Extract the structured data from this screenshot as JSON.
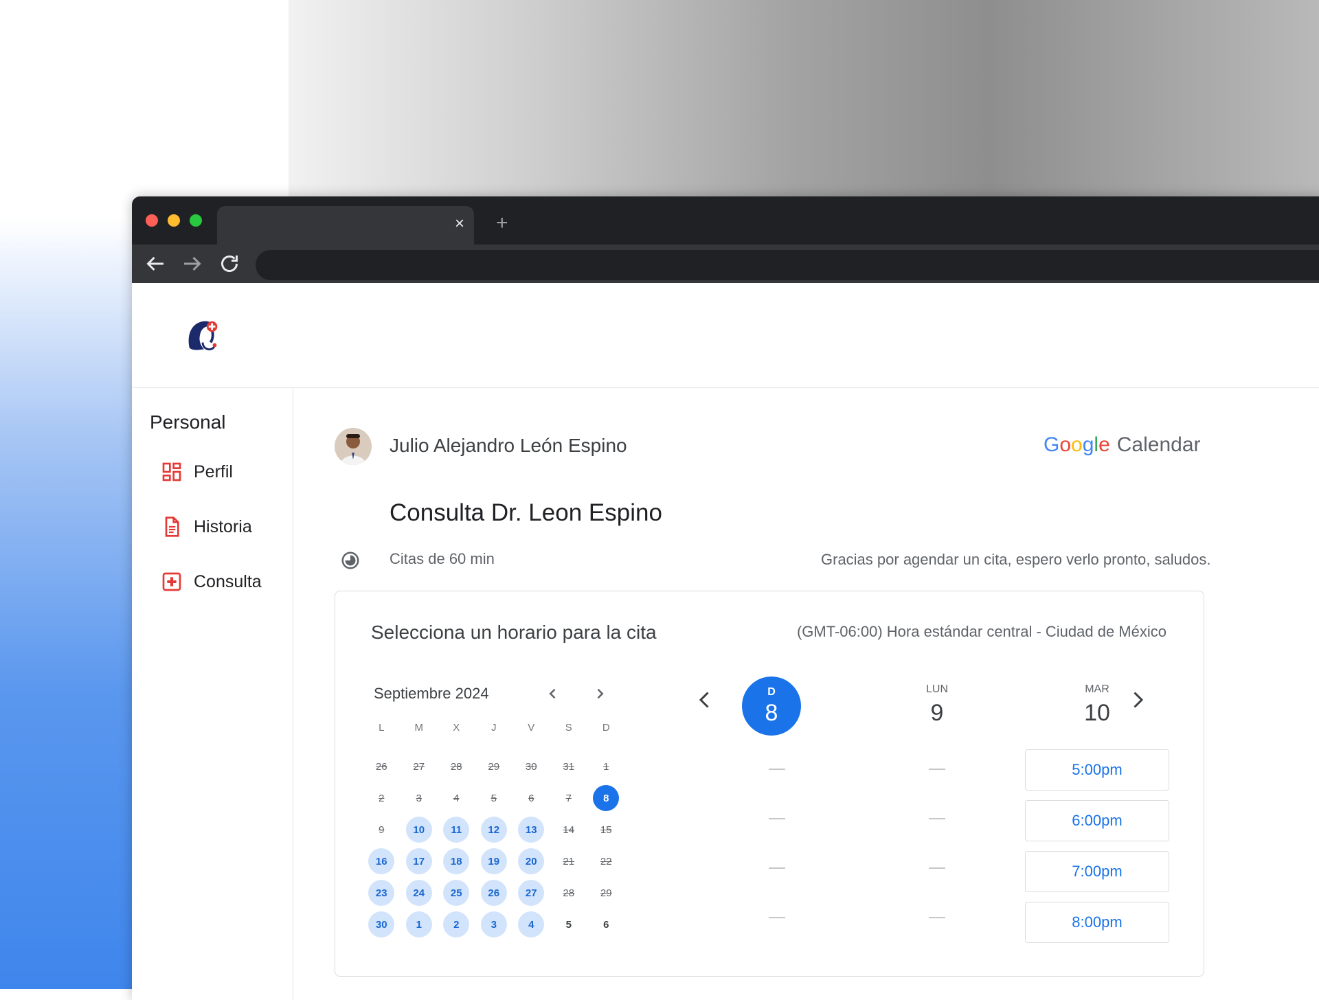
{
  "browser": {
    "tab_close": "×",
    "new_tab": "+"
  },
  "sidebar": {
    "title": "Personal",
    "items": [
      {
        "label": "Perfil",
        "icon": "dashboard-icon"
      },
      {
        "label": "Historia",
        "icon": "document-icon"
      },
      {
        "label": "Consulta",
        "icon": "medical-cross-icon"
      }
    ]
  },
  "header": {
    "doctor_name": "Julio Alejandro León Espino",
    "brand": {
      "google": [
        "G",
        "o",
        "o",
        "g",
        "l",
        "e"
      ],
      "calendar": "Calendar"
    }
  },
  "event": {
    "title": "Consulta Dr. Leon Espino",
    "duration": "Citas de 60 min",
    "welcome": "Gracias por agendar un cita, espero verlo pronto, saludos."
  },
  "booking": {
    "title": "Selecciona un horario para la cita",
    "timezone": "(GMT-06:00) Hora estándar central - Ciudad de México",
    "month_label": "Septiembre 2024",
    "dow": [
      "L",
      "M",
      "X",
      "J",
      "V",
      "S",
      "D"
    ],
    "weeks": [
      [
        {
          "d": "26",
          "s": "past"
        },
        {
          "d": "27",
          "s": "past"
        },
        {
          "d": "28",
          "s": "past"
        },
        {
          "d": "29",
          "s": "past"
        },
        {
          "d": "30",
          "s": "past"
        },
        {
          "d": "31",
          "s": "past"
        },
        {
          "d": "1",
          "s": "past"
        }
      ],
      [
        {
          "d": "2",
          "s": "past"
        },
        {
          "d": "3",
          "s": "past"
        },
        {
          "d": "4",
          "s": "past"
        },
        {
          "d": "5",
          "s": "past"
        },
        {
          "d": "6",
          "s": "past"
        },
        {
          "d": "7",
          "s": "past"
        },
        {
          "d": "8",
          "s": "selected"
        }
      ],
      [
        {
          "d": "9",
          "s": "past"
        },
        {
          "d": "10",
          "s": "avail"
        },
        {
          "d": "11",
          "s": "avail"
        },
        {
          "d": "12",
          "s": "avail"
        },
        {
          "d": "13",
          "s": "avail"
        },
        {
          "d": "14",
          "s": "past"
        },
        {
          "d": "15",
          "s": "past"
        }
      ],
      [
        {
          "d": "16",
          "s": "avail"
        },
        {
          "d": "17",
          "s": "avail"
        },
        {
          "d": "18",
          "s": "avail"
        },
        {
          "d": "19",
          "s": "avail"
        },
        {
          "d": "20",
          "s": "avail"
        },
        {
          "d": "21",
          "s": "past"
        },
        {
          "d": "22",
          "s": "past"
        }
      ],
      [
        {
          "d": "23",
          "s": "avail"
        },
        {
          "d": "24",
          "s": "avail"
        },
        {
          "d": "25",
          "s": "avail"
        },
        {
          "d": "26",
          "s": "avail"
        },
        {
          "d": "27",
          "s": "avail"
        },
        {
          "d": "28",
          "s": "past"
        },
        {
          "d": "29",
          "s": "past"
        }
      ],
      [
        {
          "d": "30",
          "s": "avail"
        },
        {
          "d": "1",
          "s": "avail"
        },
        {
          "d": "2",
          "s": "avail"
        },
        {
          "d": "3",
          "s": "avail"
        },
        {
          "d": "4",
          "s": "avail"
        },
        {
          "d": "5",
          "s": "normal"
        },
        {
          "d": "6",
          "s": "normal"
        }
      ]
    ],
    "days": [
      {
        "name": "D",
        "date": "8",
        "selected": true,
        "slots": [
          "",
          "",
          "",
          ""
        ]
      },
      {
        "name": "LUN",
        "date": "9",
        "selected": false,
        "slots": [
          "",
          "",
          "",
          ""
        ]
      },
      {
        "name": "MAR",
        "date": "10",
        "selected": false,
        "slots": [
          "5:00pm",
          "6:00pm",
          "7:00pm",
          "8:00pm"
        ]
      }
    ]
  },
  "colors": {
    "accent": "#1a73e8",
    "available_bg": "#d2e3fc",
    "brand_red": "#e53935"
  }
}
